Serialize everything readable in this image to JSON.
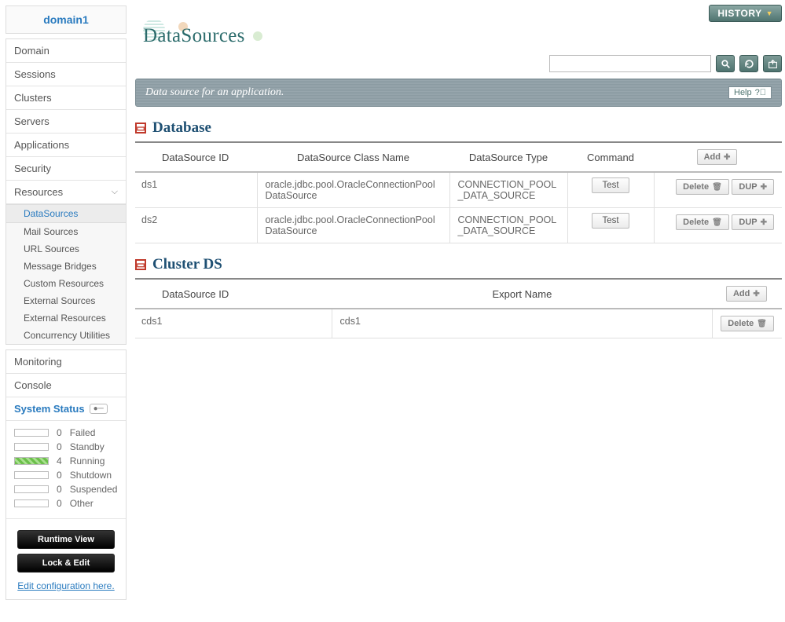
{
  "domain": "domain1",
  "nav": {
    "items": [
      "Domain",
      "Sessions",
      "Clusters",
      "Servers",
      "Applications",
      "Security",
      "Resources"
    ],
    "resources_sub": [
      "DataSources",
      "Mail Sources",
      "URL Sources",
      "Message Bridges",
      "Custom Resources",
      "External Sources",
      "External Resources",
      "Concurrency Utilities"
    ],
    "active_sub": "DataSources",
    "monitoring": "Monitoring",
    "console": "Console"
  },
  "status": {
    "title": "System Status",
    "rows": [
      {
        "count": "0",
        "label": "Failed"
      },
      {
        "count": "0",
        "label": "Standby"
      },
      {
        "count": "4",
        "label": "Running",
        "style": "running"
      },
      {
        "count": "0",
        "label": "Shutdown"
      },
      {
        "count": "0",
        "label": "Suspended"
      },
      {
        "count": "0",
        "label": "Other"
      }
    ]
  },
  "buttons": {
    "runtime": "Runtime View",
    "lockedit": "Lock & Edit",
    "editlink": "Edit configuration here."
  },
  "topbar": {
    "history": "HISTORY"
  },
  "page_title": "DataSources",
  "search": {
    "placeholder": ""
  },
  "banner": {
    "text": "Data source for an application.",
    "help": "Help"
  },
  "database": {
    "title": "Database",
    "headers": [
      "DataSource ID",
      "DataSource Class Name",
      "DataSource Type",
      "Command"
    ],
    "add": "Add",
    "rows": [
      {
        "id": "ds1",
        "class": "oracle.jdbc.pool.OracleConnectionPoolDataSource",
        "type": "CONNECTION_POOL_DATA_SOURCE",
        "test": "Test",
        "delete": "Delete",
        "dup": "DUP"
      },
      {
        "id": "ds2",
        "class": "oracle.jdbc.pool.OracleConnectionPoolDataSource",
        "type": "CONNECTION_POOL_DATA_SOURCE",
        "test": "Test",
        "delete": "Delete",
        "dup": "DUP"
      }
    ]
  },
  "cluster": {
    "title": "Cluster DS",
    "headers": [
      "DataSource ID",
      "Export Name"
    ],
    "add": "Add",
    "rows": [
      {
        "id": "cds1",
        "export": "cds1",
        "delete": "Delete"
      }
    ]
  }
}
